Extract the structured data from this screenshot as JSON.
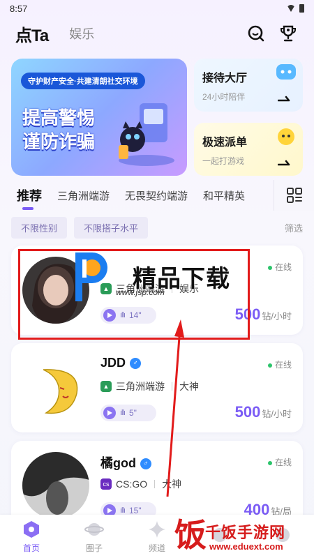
{
  "status": {
    "time": "8:57"
  },
  "header": {
    "logo": "点Ta",
    "secondary_tab": "娱乐"
  },
  "banner": {
    "top_text": "守护财产安全·共建清朗社交环境",
    "title_line1": "提高警惕",
    "title_line2": "谨防诈骗"
  },
  "side_cards": [
    {
      "title": "接待大厅",
      "subtitle": "24小时陪伴"
    },
    {
      "title": "极速派单",
      "subtitle": "一起打游戏"
    }
  ],
  "tabs": [
    "推荐",
    "三角洲端游",
    "无畏契约端游",
    "和平精英"
  ],
  "filters": {
    "chips": [
      "不限性别",
      "不限搭子水平"
    ],
    "right": "筛选"
  },
  "users": [
    {
      "name": "",
      "online": "在线",
      "tag": "三角洲端游",
      "tag2": "娱乐",
      "voice": "14\"",
      "price": "500",
      "unit": "钻/小时",
      "tag_color": "#2a9c58"
    },
    {
      "name": "JDD",
      "online": "在线",
      "tag": "三角洲端游",
      "tag2": "大神",
      "voice": "5\"",
      "price": "500",
      "unit": "钻/小时",
      "tag_color": "#2a9c58"
    },
    {
      "name": "橘god",
      "online": "在线",
      "tag": "CS:GO",
      "tag2": "大神",
      "voice": "15\"",
      "price": "400",
      "unit": "钻/局",
      "tag_color": "#6a2cc0"
    }
  ],
  "watermark": {
    "title": "精品下载",
    "url": "www.jsp.com",
    "bottom_title": "千饭手游网",
    "bottom_url": "www.eduext.com",
    "bottom_mark": "饭"
  },
  "bottom_nav": [
    "首页",
    "圈子",
    "频道",
    "",
    ""
  ],
  "colors": {
    "accent": "#7b5cf5",
    "highlight": "#e21b1b",
    "online": "#2cc46b"
  }
}
